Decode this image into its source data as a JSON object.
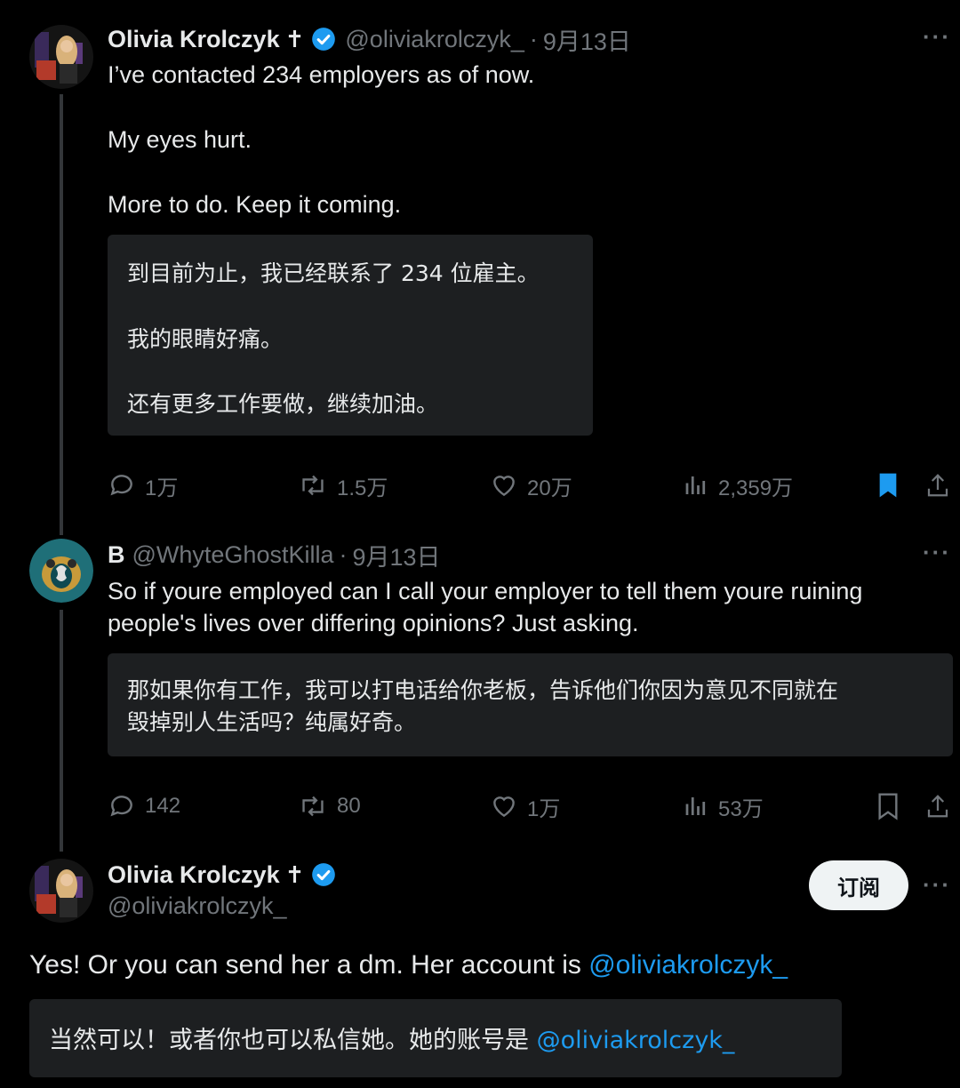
{
  "colors": {
    "background": "#000000",
    "text": "#e7e9ea",
    "muted": "#71767b",
    "accent": "#1d9bf0",
    "translation_bg": "#1d1f21"
  },
  "tweet1": {
    "name": "Olivia Krolczyk",
    "cross": "✝",
    "handle": "@oliviakrolczyk_",
    "date": "9月13日",
    "more": "···",
    "text": [
      "I’ve contacted 234 employers as of now.",
      "My eyes hurt.",
      "More to do. Keep it coming."
    ],
    "translation": [
      "到目前为止，我已经联系了 234 位雇主。",
      "我的眼睛好痛。",
      "还有更多工作要做，继续加油。"
    ],
    "actions": {
      "replies": "1万",
      "retweets": "1.5万",
      "likes": "20万",
      "views": "2,359万",
      "bookmarked": true
    }
  },
  "tweet2": {
    "name": "B",
    "handle": "@WhyteGhostKilla",
    "date": "9月13日",
    "more": "···",
    "text": [
      "So if youre employed can I call your employer to tell them youre ruining",
      "people's lives over differing opinions? Just asking."
    ],
    "translation": [
      "那如果你有工作，我可以打电话给你老板，告诉他们你因为意见不同就在",
      "毁掉别人生活吗？纯属好奇。"
    ],
    "actions": {
      "replies": "142",
      "retweets": "80",
      "likes": "1万",
      "views": "53万",
      "bookmarked": false
    }
  },
  "tweet3": {
    "name": "Olivia Krolczyk",
    "cross": "✝",
    "handle": "@oliviakrolczyk_",
    "subscribe_label": "订阅",
    "more": "···",
    "text_prefix": "Yes! Or you can send her a dm. Her account is ",
    "text_mention": "@oliviakrolczyk_",
    "translation_prefix": "当然可以！或者你也可以私信她。她的账号是 ",
    "translation_mention": "@oliviakrolczyk_"
  }
}
